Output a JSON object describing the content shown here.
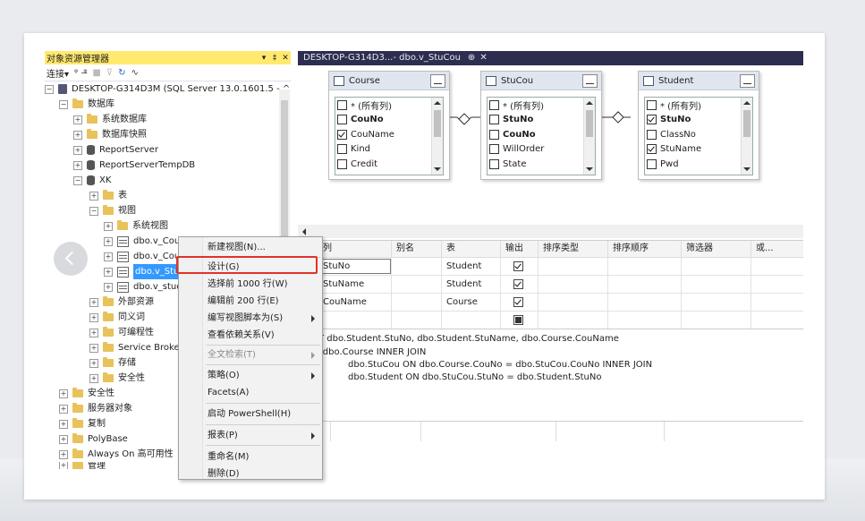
{
  "explorer": {
    "title": "对象资源管理器",
    "title_icons": [
      "▾",
      "‡",
      "✕"
    ],
    "toolbar": [
      "连接▾",
      "connect-icon",
      "disconnect-icon",
      "stop-icon",
      "filter-icon",
      "refresh-icon",
      "activity-icon"
    ],
    "connect_label": "连接▾",
    "server": "DESKTOP-G314D3M (SQL Server 13.0.1601.5 - ^",
    "nodes": {
      "databases": "数据库",
      "system_db": "系统数据库",
      "snapshots": "数据库快照",
      "report_server": "ReportServer",
      "report_temp": "ReportServerTempDB",
      "xk": "XK",
      "tables": "表",
      "views": "视图",
      "system_views": "系统视图",
      "v_cou": "dbo.v_Cou",
      "v_cou2": "dbo.v_Cou",
      "v_stucou": "dbo.v_StuC",
      "v_stud": "dbo.v_stud",
      "external": "外部资源",
      "synonyms": "同义词",
      "programmability": "可编程性",
      "service_broker": "Service Broker",
      "storage": "存储",
      "security_inner": "安全性",
      "security": "安全性",
      "server_objects": "服务器对象",
      "replication": "复制",
      "polybase": "PolyBase",
      "always_on": "Always On 高可用性",
      "management": "管理"
    }
  },
  "tab": {
    "title": "DESKTOP-G314D3...- dbo.v_StuCou",
    "pin": "⊕",
    "close": "✕"
  },
  "diagram": {
    "tables": [
      {
        "name": "Course",
        "columns": [
          {
            "label": "* (所有列)",
            "checked": false,
            "bold": false
          },
          {
            "label": "CouNo",
            "checked": false,
            "bold": true
          },
          {
            "label": "CouName",
            "checked": true,
            "bold": false
          },
          {
            "label": "Kind",
            "checked": false,
            "bold": false
          },
          {
            "label": "Credit",
            "checked": false,
            "bold": false
          }
        ]
      },
      {
        "name": "StuCou",
        "columns": [
          {
            "label": "* (所有列)",
            "checked": false,
            "bold": false
          },
          {
            "label": "StuNo",
            "checked": false,
            "bold": true
          },
          {
            "label": "CouNo",
            "checked": false,
            "bold": true
          },
          {
            "label": "WillOrder",
            "checked": false,
            "bold": false
          },
          {
            "label": "State",
            "checked": false,
            "bold": false
          }
        ]
      },
      {
        "name": "Student",
        "columns": [
          {
            "label": "* (所有列)",
            "checked": false,
            "bold": false
          },
          {
            "label": "StuNo",
            "checked": true,
            "bold": true
          },
          {
            "label": "ClassNo",
            "checked": false,
            "bold": false
          },
          {
            "label": "StuName",
            "checked": true,
            "bold": false
          },
          {
            "label": "Pwd",
            "checked": false,
            "bold": false
          }
        ]
      }
    ]
  },
  "grid": {
    "headers": [
      "列",
      "别名",
      "表",
      "输出",
      "排序类型",
      "排序顺序",
      "筛选器",
      "或..."
    ],
    "rows": [
      {
        "column": "StuNo",
        "alias": "",
        "table": "Student",
        "output": "checked"
      },
      {
        "column": "StuName",
        "alias": "",
        "table": "Student",
        "output": "checked"
      },
      {
        "column": "CouName",
        "alias": "",
        "table": "Course",
        "output": "checked"
      },
      {
        "column": "",
        "alias": "",
        "table": "",
        "output": "indeterminate"
      }
    ]
  },
  "sql": {
    "line1": "CT   dbo.Student.StuNo, dbo.Student.StuName, dbo.Course.CouName",
    "line2": "M       dbo.Course INNER JOIN",
    "line3": "dbo.StuCou ON dbo.Course.CouNo = dbo.StuCou.CouNo INNER JOIN",
    "line4": "dbo.Student ON dbo.StuCou.StuNo = dbo.Student.StuNo"
  },
  "menu": {
    "new_view": "新建视图(N)...",
    "design": "设计(G)",
    "select_top": "选择前 1000 行(W)",
    "edit_top": "编辑前 200 行(E)",
    "script_as": "编写视图脚本为(S)",
    "view_deps": "查看依赖关系(V)",
    "fulltext": "全文检索(T)",
    "policies": "策略(O)",
    "facets": "Facets(A)",
    "powershell": "启动 PowerShell(H)",
    "reports": "报表(P)",
    "rename": "重命名(M)",
    "delete": "删除(D)"
  },
  "colors": {
    "highlight": "#e0322a",
    "selection": "#3399ff",
    "tabbar": "#2d2d50",
    "titlebar": "#ffe96e"
  }
}
